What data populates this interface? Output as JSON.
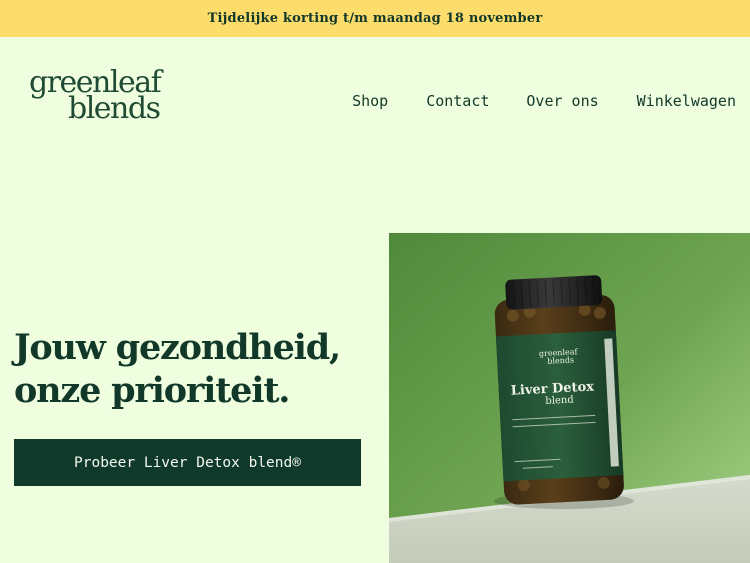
{
  "promo": {
    "text": "Tijdelijke korting t/m maandag 18 november"
  },
  "brand": {
    "line1": "greenleaf",
    "line2": "blends"
  },
  "nav": {
    "items": [
      "Shop",
      "Contact",
      "Over ons",
      "Winkelwagen"
    ]
  },
  "hero": {
    "title_line1": "Jouw gezondheid,",
    "title_line2": "onze prioriteit.",
    "cta_label": "Probeer Liver Detox blend®"
  },
  "product": {
    "label_brand_line1": "greenleaf",
    "label_brand_line2": "blends",
    "label_name": "Liver Detox",
    "label_sub": "blend"
  },
  "colors": {
    "background": "#effedf",
    "promo_bar": "#fcdc6b",
    "primary": "#0f3a2b",
    "text": "#12382a"
  }
}
